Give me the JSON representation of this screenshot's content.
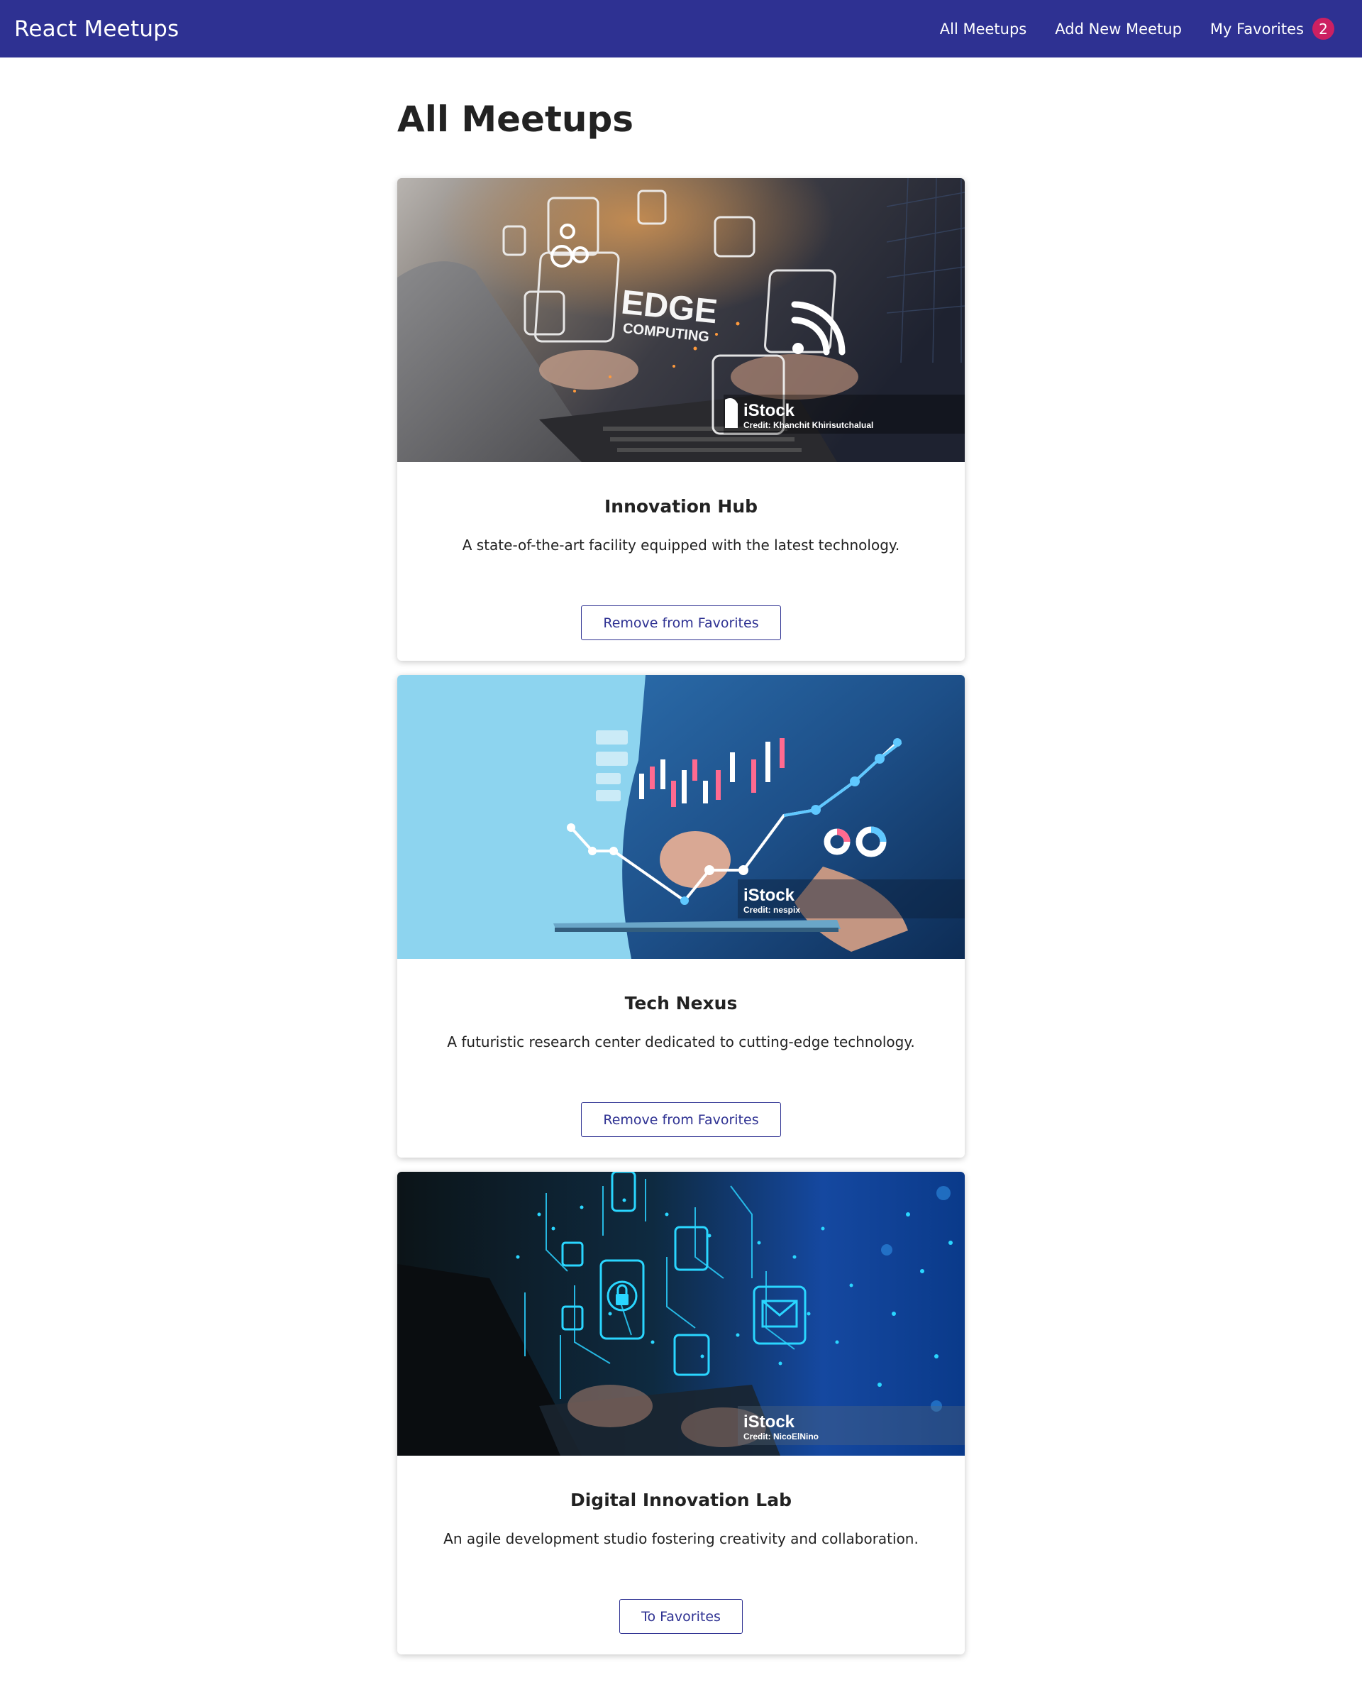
{
  "header": {
    "logo": "React Meetups",
    "nav": {
      "all_meetups": "All Meetups",
      "add_new": "Add New Meetup",
      "favorites": "My Favorites",
      "favorites_count": "2"
    }
  },
  "page": {
    "title": "All Meetups"
  },
  "meetups": [
    {
      "title": "Innovation Hub",
      "description": "A state-of-the-art facility equipped with the latest technology.",
      "button": "Remove from Favorites",
      "image": {
        "subject": "edge-computing-laptop",
        "overlay_text_1": "EDGE",
        "overlay_text_2": "COMPUTING",
        "watermark": "iStock",
        "credit": "Credit: Khanchit Khirisutchalual"
      }
    },
    {
      "title": "Tech Nexus",
      "description": "A futuristic research center dedicated to cutting-edge technology.",
      "button": "Remove from Favorites",
      "image": {
        "subject": "finance-chart-tablet",
        "watermark": "iStock",
        "credit": "Credit: nespix"
      }
    },
    {
      "title": "Digital Innovation Lab",
      "description": "An agile development studio fostering creativity and collaboration.",
      "button": "To Favorites",
      "image": {
        "subject": "cyber-security-circuit",
        "watermark": "iStock",
        "credit": "Credit: NicoElNino"
      }
    }
  ],
  "colors": {
    "header_bg": "#2e3192",
    "badge_bg": "#cc2062",
    "button_border": "#2e3192"
  }
}
